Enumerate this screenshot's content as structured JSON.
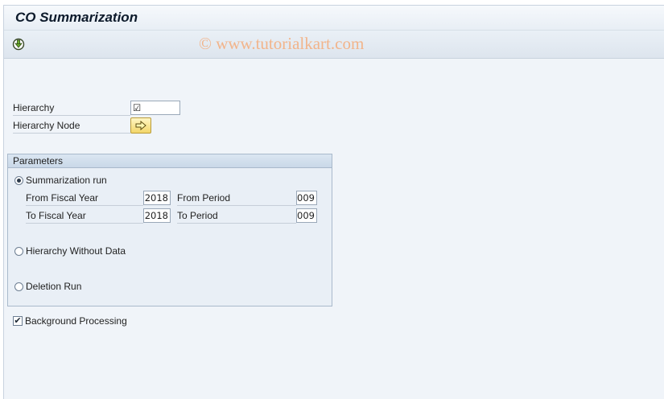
{
  "window": {
    "title": "CO Summarization"
  },
  "watermark": "© www.tutorialkart.com",
  "form": {
    "hierarchy_label": "Hierarchy",
    "hierarchy_value": "☑",
    "hierarchy_node_label": "Hierarchy Node"
  },
  "parameters": {
    "title": "Parameters",
    "summarization_run_label": "Summarization run",
    "from_fiscal_year_label": "From Fiscal Year",
    "from_fiscal_year_value": "2018",
    "from_period_label": "From Period",
    "from_period_value": "009",
    "to_fiscal_year_label": "To Fiscal Year",
    "to_fiscal_year_value": "2018",
    "to_period_label": "To Period",
    "to_period_value": "009",
    "hierarchy_without_data_label": "Hierarchy Without Data",
    "deletion_run_label": "Deletion Run",
    "selected_option": "summarization_run"
  },
  "background": {
    "label": "Background Processing",
    "checked": true,
    "check_glyph": "✔"
  },
  "icons": {
    "execute": "execute-icon",
    "multiple_selection": "arrow-right-icon"
  }
}
